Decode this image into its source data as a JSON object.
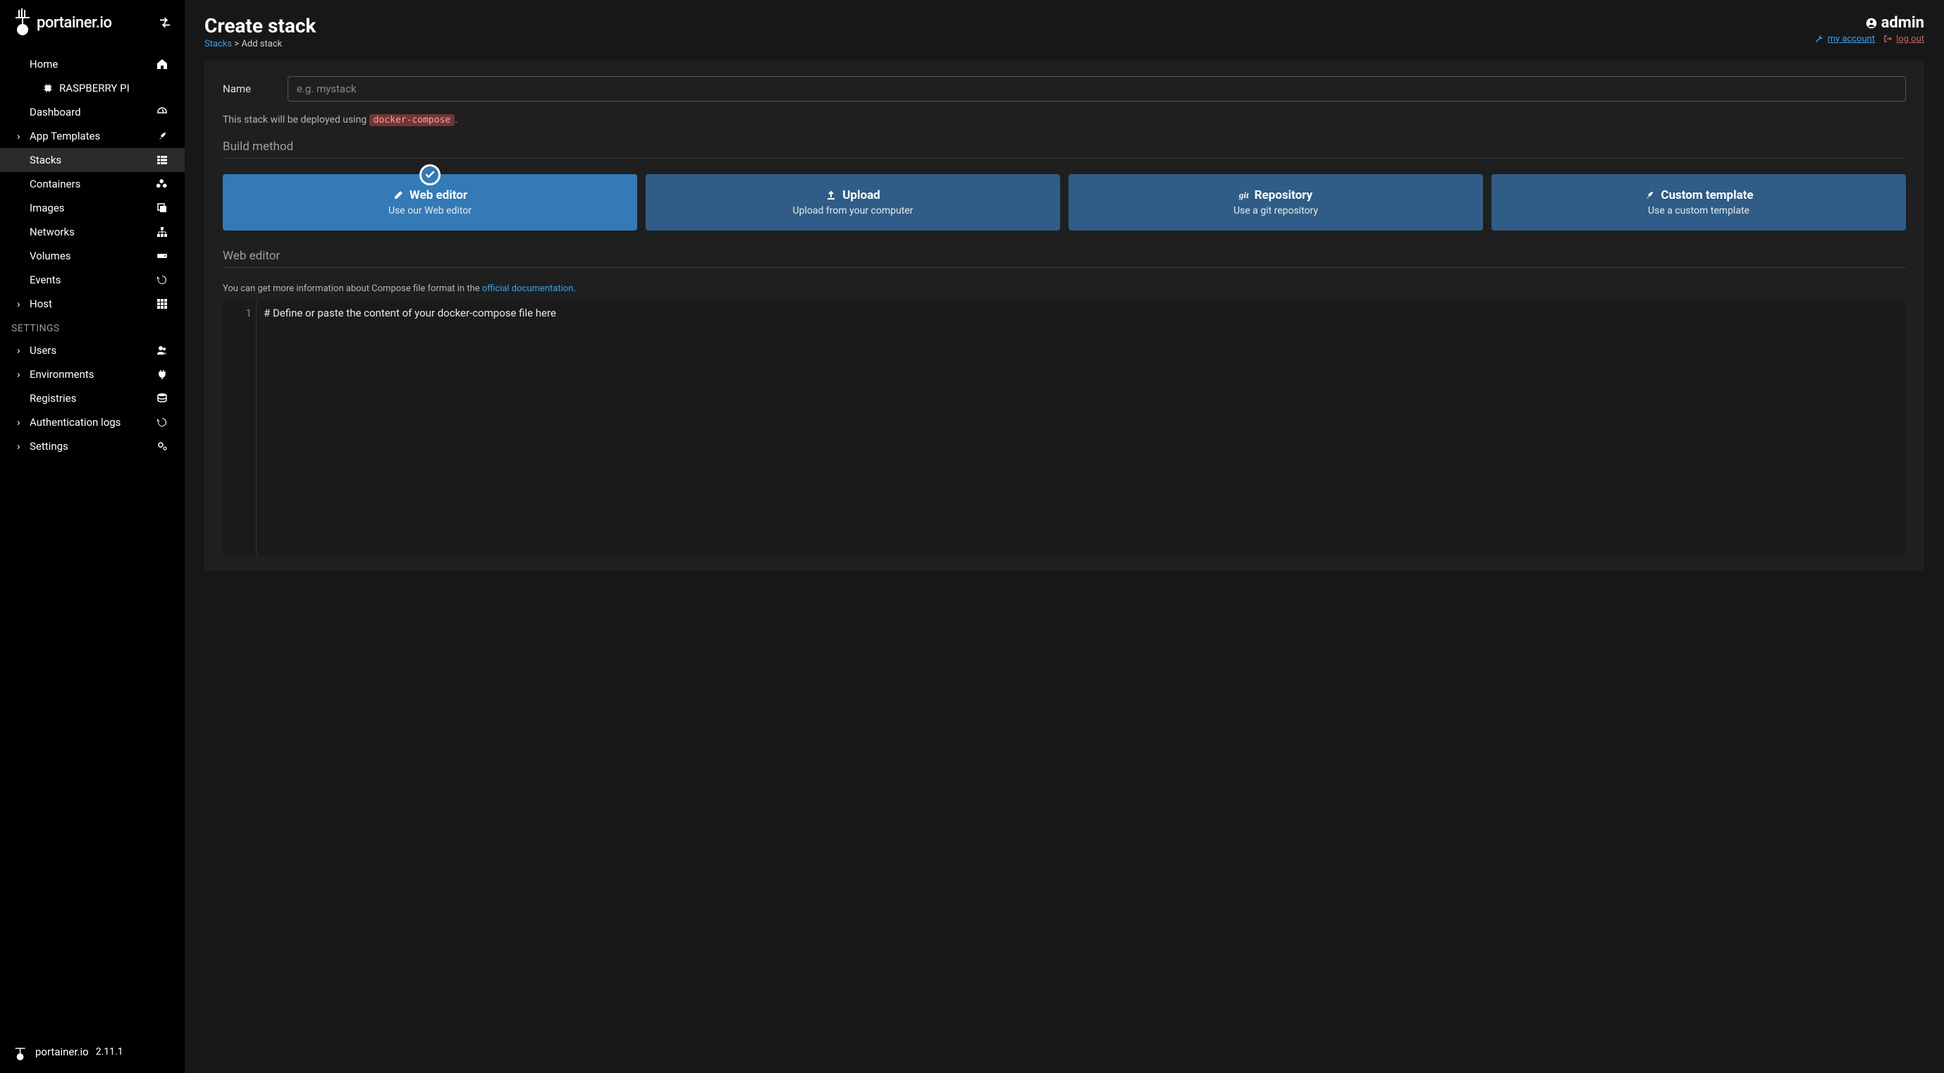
{
  "brand": "portainer.io",
  "version": "2.11.1",
  "user": {
    "name": "admin",
    "my_account": "my account",
    "log_out": "log out"
  },
  "page": {
    "title": "Create stack",
    "bc_root": "Stacks",
    "bc_sep": ">",
    "bc_leaf": "Add stack"
  },
  "sidebar": {
    "endpoint": "RASPBERRY PI",
    "items": [
      {
        "label": "Home",
        "icon": "home"
      },
      {
        "label": "Dashboard",
        "icon": "tachometer"
      },
      {
        "label": "App Templates",
        "icon": "rocket",
        "expandable": true
      },
      {
        "label": "Stacks",
        "icon": "th-list",
        "active": true
      },
      {
        "label": "Containers",
        "icon": "cubes"
      },
      {
        "label": "Images",
        "icon": "clone"
      },
      {
        "label": "Networks",
        "icon": "sitemap"
      },
      {
        "label": "Volumes",
        "icon": "hdd"
      },
      {
        "label": "Events",
        "icon": "history"
      },
      {
        "label": "Host",
        "icon": "th",
        "expandable": true
      }
    ],
    "settings_label": "SETTINGS",
    "settings": [
      {
        "label": "Users",
        "icon": "users",
        "expandable": true
      },
      {
        "label": "Environments",
        "icon": "plug",
        "expandable": true
      },
      {
        "label": "Registries",
        "icon": "database"
      },
      {
        "label": "Authentication logs",
        "icon": "history",
        "expandable": true
      },
      {
        "label": "Settings",
        "icon": "cogs",
        "expandable": true
      }
    ]
  },
  "form": {
    "name_label": "Name",
    "name_placeholder": "e.g. mystack",
    "deploy_note_pre": "This stack will be deployed using ",
    "deploy_note_code": "docker-compose",
    "deploy_note_post": ".",
    "build_method_label": "Build method",
    "methods": [
      {
        "title": "Web editor",
        "sub": "Use our Web editor",
        "selected": true
      },
      {
        "title": "Upload",
        "sub": "Upload from your computer"
      },
      {
        "title": "Repository",
        "sub": "Use a git repository"
      },
      {
        "title": "Custom template",
        "sub": "Use a custom template"
      }
    ],
    "editor_section_label": "Web editor",
    "info_pre": "You can get more information about Compose file format in the ",
    "info_link": "official documentation",
    "info_post": ".",
    "gutter_line": "1",
    "editor_placeholder": "# Define or paste the content of your docker-compose file here"
  }
}
